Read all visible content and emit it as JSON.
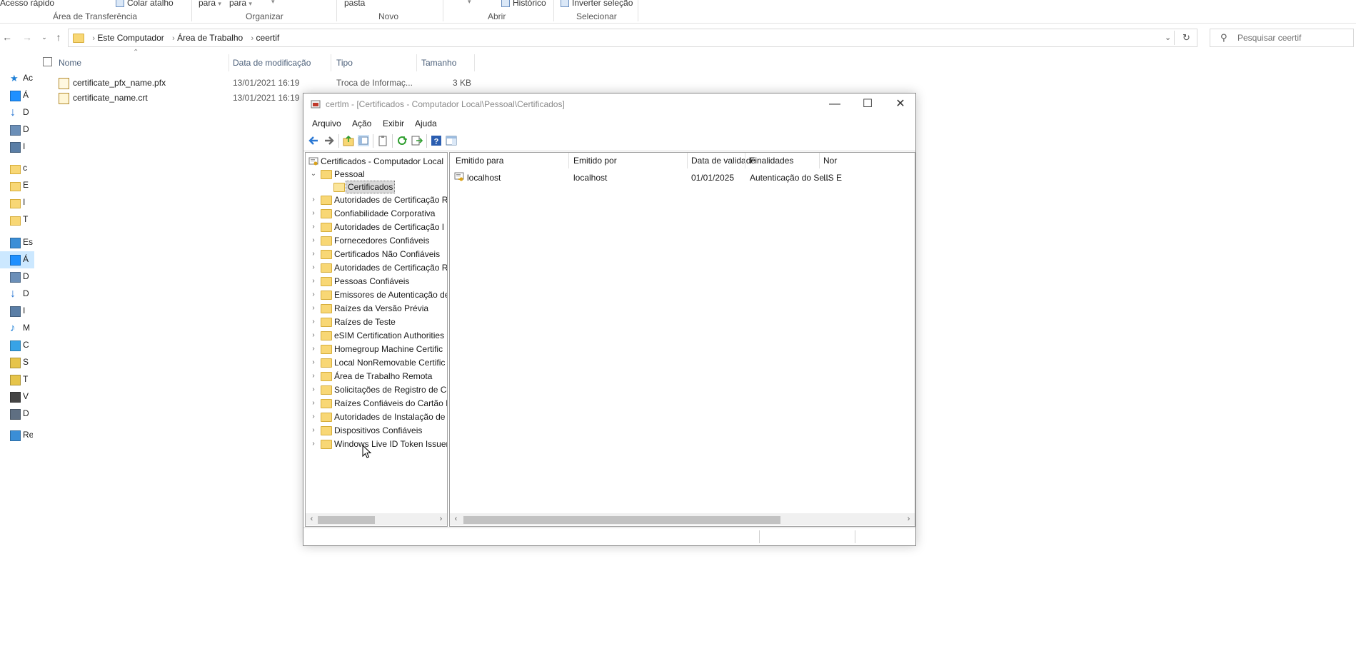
{
  "explorer": {
    "ribbon": {
      "cut_texts": [
        "Acesso rápido",
        "Colar atalho",
        "para",
        "para",
        "pasta",
        "Histórico",
        "Inverter seleção"
      ],
      "groups": [
        "Área de Transferência",
        "Organizar",
        "Novo",
        "Abrir",
        "Selecionar"
      ]
    },
    "address": {
      "crumbs": [
        "Este Computador",
        "Área de Trabalho",
        "ceertif"
      ]
    },
    "search": {
      "placeholder": "Pesquisar ceertif"
    },
    "columns": {
      "name": "Nome",
      "modified": "Data de modificação",
      "type": "Tipo",
      "size": "Tamanho"
    },
    "files": [
      {
        "name": "certificate_pfx_name.pfx",
        "modified": "13/01/2021 16:19",
        "type": "Troca de Informaç...",
        "size": "3 KB"
      },
      {
        "name": "certificate_name.crt",
        "modified": "13/01/2021 16:19",
        "type": "",
        "size": ""
      }
    ],
    "nav_items": [
      {
        "label": "Ac",
        "icon": "star-icon",
        "color": "#1e7fd6"
      },
      {
        "label": "Á",
        "icon": "desktop-icon",
        "color": "#1e90ff"
      },
      {
        "label": "D",
        "icon": "download-icon",
        "color": "#1f6fd0"
      },
      {
        "label": "D",
        "icon": "document-icon",
        "color": "#6b8fb8"
      },
      {
        "label": "I",
        "icon": "image-icon",
        "color": "#5a7ea6"
      },
      {
        "label": "c",
        "icon": "folder-icon",
        "color": "#f8d775"
      },
      {
        "label": "E",
        "icon": "folder-icon",
        "color": "#f8d775"
      },
      {
        "label": "I",
        "icon": "folder-icon",
        "color": "#f8d775"
      },
      {
        "label": "T",
        "icon": "folder-icon",
        "color": "#f8d775"
      },
      {
        "label": "Es",
        "icon": "computer-icon",
        "color": "#3b8ed6"
      },
      {
        "label": "Á",
        "icon": "desktop-icon",
        "color": "#1e90ff"
      },
      {
        "label": "D",
        "icon": "document-icon",
        "color": "#6b8fb8"
      },
      {
        "label": "D",
        "icon": "download-icon",
        "color": "#1f6fd0"
      },
      {
        "label": "I",
        "icon": "image-icon",
        "color": "#5a7ea6"
      },
      {
        "label": "M",
        "icon": "music-icon",
        "color": "#1e7fd6"
      },
      {
        "label": "C",
        "icon": "3d-objects-icon",
        "color": "#37a3e6"
      },
      {
        "label": "S",
        "icon": "drive-icon",
        "color": "#e6c44a"
      },
      {
        "label": "T",
        "icon": "drive-icon",
        "color": "#e6c44a"
      },
      {
        "label": "V",
        "icon": "video-icon",
        "color": "#444444"
      },
      {
        "label": "D",
        "icon": "disk-icon",
        "color": "#5f6f82"
      },
      {
        "label": "Re",
        "icon": "network-icon",
        "color": "#3b8ed6"
      }
    ]
  },
  "mmc": {
    "title": "certlm - [Certificados - Computador Local\\Pessoal\\Certificados]",
    "menu": [
      "Arquivo",
      "Ação",
      "Exibir",
      "Ajuda"
    ],
    "tree": {
      "root": "Certificados - Computador Local",
      "personal": "Pessoal",
      "selected": "Certificados",
      "stores": [
        "Autoridades de Certificação R",
        "Confiabilidade Corporativa",
        "Autoridades de Certificação I",
        "Fornecedores Confiáveis",
        "Certificados Não Confiáveis",
        "Autoridades de Certificação R",
        "Pessoas Confiáveis",
        "Emissores de Autenticação de",
        "Raízes da Versão Prévia",
        "Raízes de Teste",
        "eSIM Certification Authorities",
        "Homegroup Machine Certific",
        "Local NonRemovable Certific",
        "Área de Trabalho Remota",
        "Solicitações de Registro de Ce",
        "Raízes Confiáveis do Cartão In",
        "Autoridades de Instalação de",
        "Dispositivos Confiáveis",
        "Windows Live ID Token Issuer"
      ]
    },
    "list": {
      "columns": [
        "Emitido para",
        "Emitido por",
        "Data de validade",
        "Finalidades",
        "Nor"
      ],
      "rows": [
        {
          "issued_to": "localhost",
          "issued_by": "localhost",
          "expires": "01/01/2025",
          "purposes": "Autenticação do Se...",
          "friendly": "IIS E"
        }
      ]
    }
  }
}
